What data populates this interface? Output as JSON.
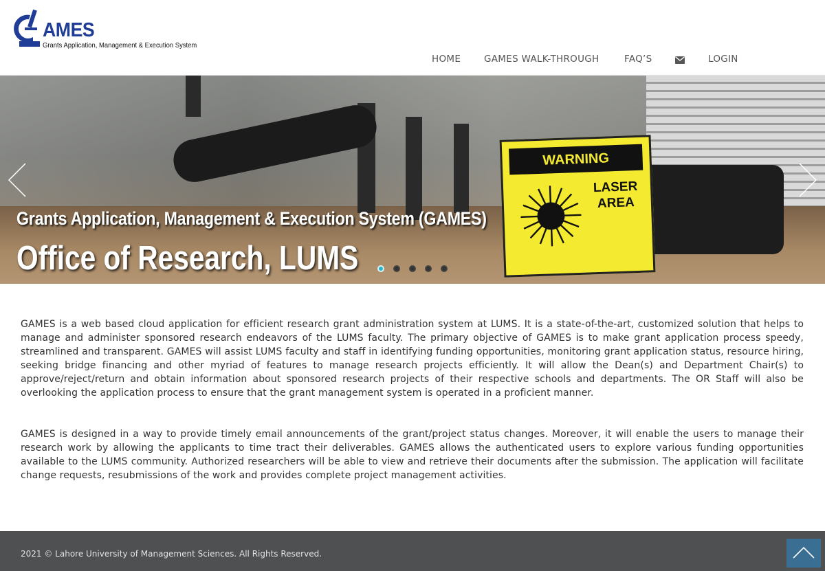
{
  "header": {
    "logo_word": "AMES",
    "logo_tagline": "Grants Application, Management & Execution System"
  },
  "nav": {
    "home": "HOME",
    "walkthrough": "GAMES WALK-THROUGH",
    "faq": "FAQ’S",
    "contact_icon": "envelope-icon",
    "login": "LOGIN"
  },
  "hero": {
    "caption_title": "Grants Application, Management & Execution System (GAMES)",
    "caption_subtitle": "Office of Research, LUMS",
    "sign_banner": "WARNING",
    "sign_line1": "LASER",
    "sign_line2": "AREA",
    "prev_icon": "chevron-left-icon",
    "next_icon": "chevron-right-icon",
    "slide_count": 5,
    "active_slide": 1
  },
  "content": {
    "paragraph1": "GAMES is a web based cloud application for efficient research grant administration system at LUMS. It is a state-of-the-art, customized solution that helps to manage and administer sponsored research endeavors of the LUMS faculty. The primary objective of GAMES is to make grant application process speedy, streamlined and transparent. GAMES will assist LUMS faculty and staff in identifying funding opportunities, monitoring grant application status, resource hiring, seeking bridge financing and other myriad of features to manage research projects efficiently. It will allow the Dean(s) and Department Chair(s) to approve/reject/return and obtain information about sponsored research projects of their respective schools and departments. The OR Staff will also be overlooking the application process to ensure that the grant management system is operated in a proficient manner.",
    "paragraph2": "GAMES is designed in a way to provide timely email announcements of the grant/project status changes. Moreover, it will enable the users to manage their research work by allowing the applicants to time tract their deliverables. GAMES allows the authenticated users to explore various funding opportunities available to the LUMS community. Authorized researchers will be able to view and retrieve their documents after the submission. The application will facilitate change requests, resubmissions of the work and provides complete project management activities."
  },
  "footer": {
    "copyright": "2021 © Lahore University of Management Sciences. All Rights Reserved.",
    "back_to_top_icon": "chevron-up-icon"
  },
  "colors": {
    "brand_blue": "#1f3d97",
    "footer_bg": "#4e5052",
    "back_to_top_bg": "#3a6f93",
    "active_dot": "#2bb3c8"
  }
}
